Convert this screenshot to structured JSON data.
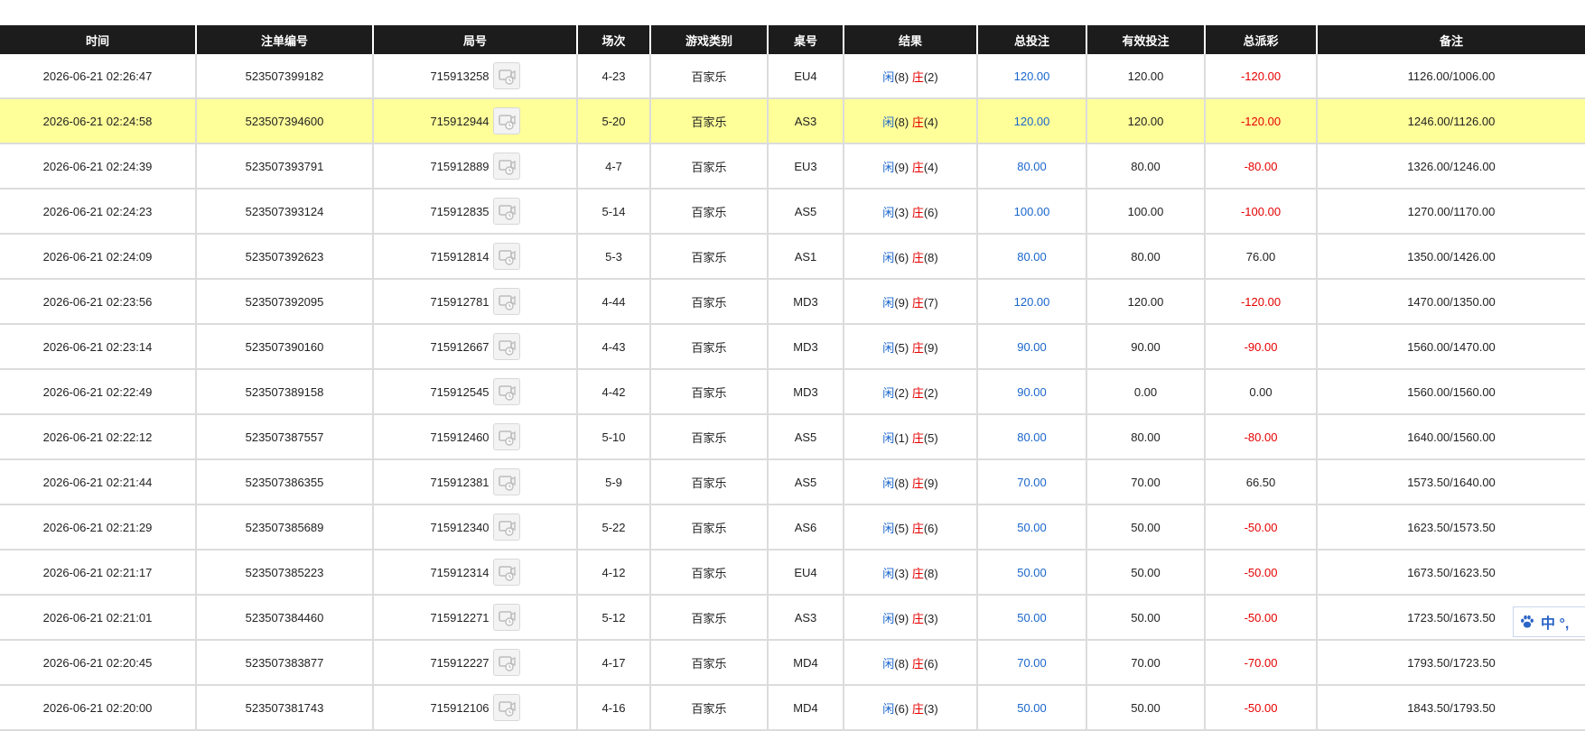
{
  "table": {
    "columns": [
      "时间",
      "注单编号",
      "局号",
      "场次",
      "游戏类别",
      "桌号",
      "结果",
      "总投注",
      "有效投注",
      "总派彩",
      "备注"
    ],
    "player_label": "闲",
    "banker_label": "庄",
    "rows": [
      {
        "time": "2026-06-21 02:26:47",
        "order": "523507399182",
        "round": "715913258",
        "shoe": "4-23",
        "game": "百家乐",
        "table": "EU4",
        "player": "(8)",
        "banker": "(2)",
        "bet": "120.00",
        "valid": "120.00",
        "payout": "-120.00",
        "payout_neg": true,
        "note": "1126.00/1006.00",
        "highlight": false
      },
      {
        "time": "2026-06-21 02:24:58",
        "order": "523507394600",
        "round": "715912944",
        "shoe": "5-20",
        "game": "百家乐",
        "table": "AS3",
        "player": "(8)",
        "banker": "(4)",
        "bet": "120.00",
        "valid": "120.00",
        "payout": "-120.00",
        "payout_neg": true,
        "note": "1246.00/1126.00",
        "highlight": true
      },
      {
        "time": "2026-06-21 02:24:39",
        "order": "523507393791",
        "round": "715912889",
        "shoe": "4-7",
        "game": "百家乐",
        "table": "EU3",
        "player": "(9)",
        "banker": "(4)",
        "bet": "80.00",
        "valid": "80.00",
        "payout": "-80.00",
        "payout_neg": true,
        "note": "1326.00/1246.00",
        "highlight": false
      },
      {
        "time": "2026-06-21 02:24:23",
        "order": "523507393124",
        "round": "715912835",
        "shoe": "5-14",
        "game": "百家乐",
        "table": "AS5",
        "player": "(3)",
        "banker": "(6)",
        "bet": "100.00",
        "valid": "100.00",
        "payout": "-100.00",
        "payout_neg": true,
        "note": "1270.00/1170.00",
        "highlight": false
      },
      {
        "time": "2026-06-21 02:24:09",
        "order": "523507392623",
        "round": "715912814",
        "shoe": "5-3",
        "game": "百家乐",
        "table": "AS1",
        "player": "(6)",
        "banker": "(8)",
        "bet": "80.00",
        "valid": "80.00",
        "payout": "76.00",
        "payout_neg": false,
        "note": "1350.00/1426.00",
        "highlight": false
      },
      {
        "time": "2026-06-21 02:23:56",
        "order": "523507392095",
        "round": "715912781",
        "shoe": "4-44",
        "game": "百家乐",
        "table": "MD3",
        "player": "(9)",
        "banker": "(7)",
        "bet": "120.00",
        "valid": "120.00",
        "payout": "-120.00",
        "payout_neg": true,
        "note": "1470.00/1350.00",
        "highlight": false
      },
      {
        "time": "2026-06-21 02:23:14",
        "order": "523507390160",
        "round": "715912667",
        "shoe": "4-43",
        "game": "百家乐",
        "table": "MD3",
        "player": "(5)",
        "banker": "(9)",
        "bet": "90.00",
        "valid": "90.00",
        "payout": "-90.00",
        "payout_neg": true,
        "note": "1560.00/1470.00",
        "highlight": false
      },
      {
        "time": "2026-06-21 02:22:49",
        "order": "523507389158",
        "round": "715912545",
        "shoe": "4-42",
        "game": "百家乐",
        "table": "MD3",
        "player": "(2)",
        "banker": "(2)",
        "bet": "90.00",
        "valid": "0.00",
        "payout": "0.00",
        "payout_neg": false,
        "note": "1560.00/1560.00",
        "highlight": false
      },
      {
        "time": "2026-06-21 02:22:12",
        "order": "523507387557",
        "round": "715912460",
        "shoe": "5-10",
        "game": "百家乐",
        "table": "AS5",
        "player": "(1)",
        "banker": "(5)",
        "bet": "80.00",
        "valid": "80.00",
        "payout": "-80.00",
        "payout_neg": true,
        "note": "1640.00/1560.00",
        "highlight": false
      },
      {
        "time": "2026-06-21 02:21:44",
        "order": "523507386355",
        "round": "715912381",
        "shoe": "5-9",
        "game": "百家乐",
        "table": "AS5",
        "player": "(8)",
        "banker": "(9)",
        "bet": "70.00",
        "valid": "70.00",
        "payout": "66.50",
        "payout_neg": false,
        "note": "1573.50/1640.00",
        "highlight": false
      },
      {
        "time": "2026-06-21 02:21:29",
        "order": "523507385689",
        "round": "715912340",
        "shoe": "5-22",
        "game": "百家乐",
        "table": "AS6",
        "player": "(5)",
        "banker": "(6)",
        "bet": "50.00",
        "valid": "50.00",
        "payout": "-50.00",
        "payout_neg": true,
        "note": "1623.50/1573.50",
        "highlight": false
      },
      {
        "time": "2026-06-21 02:21:17",
        "order": "523507385223",
        "round": "715912314",
        "shoe": "4-12",
        "game": "百家乐",
        "table": "EU4",
        "player": "(3)",
        "banker": "(8)",
        "bet": "50.00",
        "valid": "50.00",
        "payout": "-50.00",
        "payout_neg": true,
        "note": "1673.50/1623.50",
        "highlight": false
      },
      {
        "time": "2026-06-21 02:21:01",
        "order": "523507384460",
        "round": "715912271",
        "shoe": "5-12",
        "game": "百家乐",
        "table": "AS3",
        "player": "(9)",
        "banker": "(3)",
        "bet": "50.00",
        "valid": "50.00",
        "payout": "-50.00",
        "payout_neg": true,
        "note": "1723.50/1673.50",
        "highlight": false
      },
      {
        "time": "2026-06-21 02:20:45",
        "order": "523507383877",
        "round": "715912227",
        "shoe": "4-17",
        "game": "百家乐",
        "table": "MD4",
        "player": "(8)",
        "banker": "(6)",
        "bet": "70.00",
        "valid": "70.00",
        "payout": "-70.00",
        "payout_neg": true,
        "note": "1793.50/1723.50",
        "highlight": false
      },
      {
        "time": "2026-06-21 02:20:00",
        "order": "523507381743",
        "round": "715912106",
        "shoe": "4-16",
        "game": "百家乐",
        "table": "MD4",
        "player": "(6)",
        "banker": "(3)",
        "bet": "50.00",
        "valid": "50.00",
        "payout": "-50.00",
        "payout_neg": true,
        "note": "1843.50/1793.50",
        "highlight": false
      }
    ]
  },
  "ime": {
    "label": "中 °,"
  },
  "colors": {
    "header_bg": "#1c1c1c",
    "highlight_row": "#ffff99",
    "player": "#1a66cc",
    "banker": "#e60000",
    "ime": "#2a64c8"
  },
  "icons": {
    "replay": "video-replay-icon",
    "ime": "paw-icon"
  }
}
